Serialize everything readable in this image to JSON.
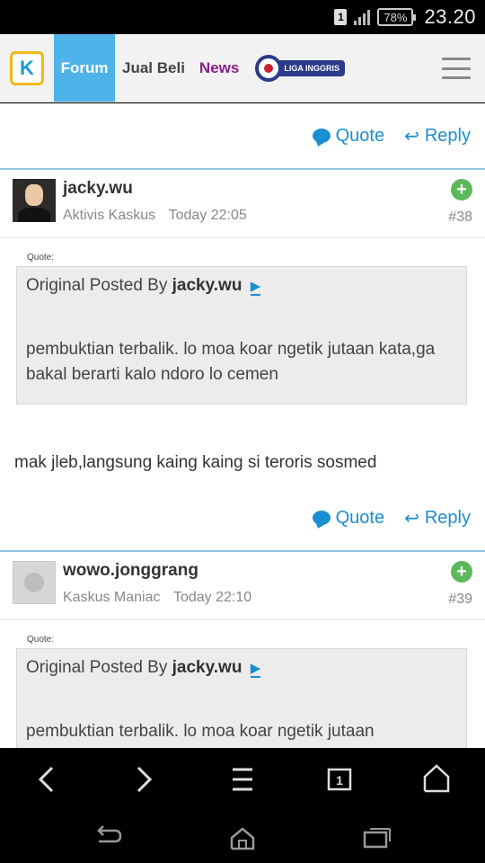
{
  "status_bar": {
    "sim_label": "1",
    "battery": "78%",
    "time": "23.20"
  },
  "header": {
    "logo_glyph": "K",
    "nav": [
      "Forum",
      "Jual Beli",
      "News"
    ],
    "liga_label": "LIGA INGGRIS"
  },
  "actions": {
    "quote_label": "Quote",
    "reply_label": "Reply"
  },
  "posts": [
    {
      "username": "jacky.wu",
      "rank": "Aktivis Kaskus",
      "time": "Today 22:05",
      "number": "#38",
      "quote_label": "Quote:",
      "quote_prefix": "Original Posted By",
      "quote_author": "jacky.wu",
      "quote_text": "pembuktian terbalik. lo moa koar ngetik jutaan kata,ga bakal berarti kalo ndoro lo cemen",
      "body": "mak jleb,langsung kaing kaing si teroris sosmed"
    },
    {
      "username": "wowo.jonggrang",
      "rank": "Kaskus Maniac",
      "time": "Today 22:10",
      "number": "#39",
      "quote_label": "Quote:",
      "quote_prefix": "Original Posted By",
      "quote_author": "jacky.wu",
      "quote_text": "pembuktian terbalik. lo moa koar ngetik jutaan"
    }
  ],
  "browser_nav": [
    "back-icon",
    "forward-icon",
    "menu-icon",
    "tabs-icon",
    "home-icon"
  ],
  "browser_tab_count": "1",
  "system_nav": [
    "back-icon",
    "home-icon",
    "recents-icon"
  ],
  "colors": {
    "accent": "#1a8fd1",
    "forum_tab": "#4eb3e8",
    "news": "#8b1d8b",
    "plus": "#5cb85c"
  }
}
